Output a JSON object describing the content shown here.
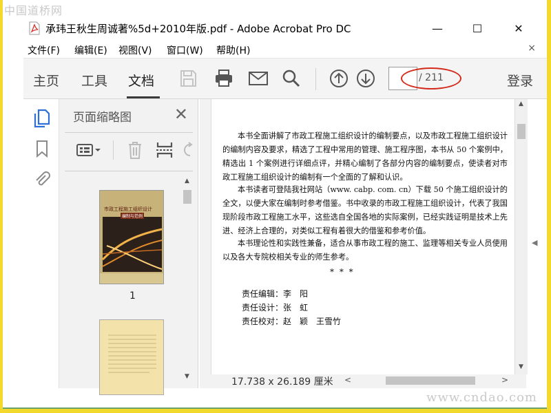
{
  "watermark_top": "中国道桥网",
  "watermark_bottom": "www.cndao.com",
  "window": {
    "title": "承玮王秋生周诚著%5d+2010年版.pdf - Adobe Acrobat Pro DC",
    "minimize_glyph": "—",
    "maximize_glyph": "☐",
    "close_glyph": "✕"
  },
  "menu": {
    "items": [
      {
        "label": "文件(F)"
      },
      {
        "label": "编辑(E)"
      },
      {
        "label": "视图(V)"
      },
      {
        "label": "窗口(W)"
      },
      {
        "label": "帮助(H)"
      }
    ],
    "close_glyph": "×"
  },
  "toolbar": {
    "tabs": [
      {
        "label": "主页"
      },
      {
        "label": "工具"
      },
      {
        "label": "文档"
      }
    ],
    "active_tab": "文档",
    "icons": [
      "save-icon",
      "print-icon",
      "email-icon",
      "search-icon",
      "arrow-up-icon",
      "arrow-down-icon"
    ],
    "current_page": "",
    "page_total": "/ 211",
    "login_label": "登录"
  },
  "left_rail": {
    "icons": [
      "page-thumbnails-icon",
      "bookmark-icon",
      "attachment-icon"
    ],
    "accent_color": "#2d6fd6"
  },
  "thumbnails_panel": {
    "title": "页面缩略图",
    "close_glyph": "✕",
    "tool_icons": [
      "options-menu-icon",
      "delete-icon",
      "insert-page-icon",
      "rotate-icon"
    ],
    "pages": [
      {
        "label": "1",
        "cover_title": "市政工程施工组织设计",
        "cover_subtitle": "编制与范例"
      },
      {
        "label": ""
      }
    ]
  },
  "document": {
    "paragraphs": [
      "本书全面讲解了市政工程施工组织设计的编制要点，以及市政工程施工组织设计的编制内容及要求，精选了工程中常用的管理、施工程序图，本书从 50 个案例中，精选出 1 个案例进行详细点评，并精心编制了各部分内容的编制要点，使读者对市政工程施工组织设计的编制有一个全面的了解和认识。",
      "本书读者可登陆我社网站（www. cabp. com. cn）下载 50 个施工组织设计的全文，以便大家在编制时参考借鉴。书中收录的市政工程施工组织设计，代表了我国现阶段市政工程施工水平，这些选自全国各地的实际案例，已经实践证明是技术上先进、经济上合理的，对类似工程有着很大的借鉴和参考价值。",
      "本书理论性和实践性兼备，适合从事市政工程的施工、监理等相关专业人员使用以及各大专院校相关专业的师生参考。"
    ],
    "separator": "*  *  *",
    "credits": [
      {
        "role": "责任编辑：",
        "name": "李　阳"
      },
      {
        "role": "责任设计：",
        "name": "张　虹"
      },
      {
        "role": "责任校对：",
        "name": "赵　颖　王雪竹"
      }
    ]
  },
  "status": {
    "page_dimensions": "17.738 x 26.189 厘米"
  },
  "colors": {
    "annotation_ellipse": "#d42a1a",
    "background_frame": "#f2d92c"
  }
}
